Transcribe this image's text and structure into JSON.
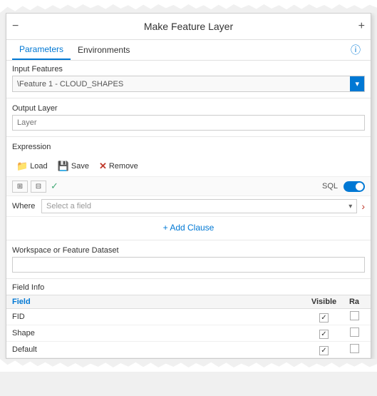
{
  "header": {
    "title": "Make Feature Layer",
    "back_label": "−",
    "plus_label": "+",
    "info_label": "ⓘ"
  },
  "tabs": {
    "items": [
      {
        "id": "parameters",
        "label": "Parameters",
        "active": true
      },
      {
        "id": "environments",
        "label": "Environments",
        "active": false
      }
    ]
  },
  "input_features": {
    "label": "Input Features",
    "value": "\\Feature 1 - CLOUD_SHAPES",
    "placeholder": ""
  },
  "output_layer": {
    "label": "Output Layer",
    "placeholder": "Layer"
  },
  "expression": {
    "label": "Expression",
    "load_label": "Load",
    "save_label": "Save",
    "remove_label": "Remove",
    "sql_label": "SQL"
  },
  "where_clause": {
    "where_label": "Where",
    "field_placeholder": "Select a field",
    "add_clause_label": "+ Add Clause"
  },
  "workspace": {
    "label": "Workspace or Feature Dataset",
    "value": ""
  },
  "field_info": {
    "label": "Field Info",
    "columns": {
      "field": "Field",
      "visible": "Visible",
      "ra": "Ra"
    },
    "rows": [
      {
        "field": "FID",
        "visible": true,
        "ra": false
      },
      {
        "field": "Shape",
        "visible": true,
        "ra": false
      },
      {
        "field": "Default",
        "visible": true,
        "ra": false
      }
    ]
  }
}
